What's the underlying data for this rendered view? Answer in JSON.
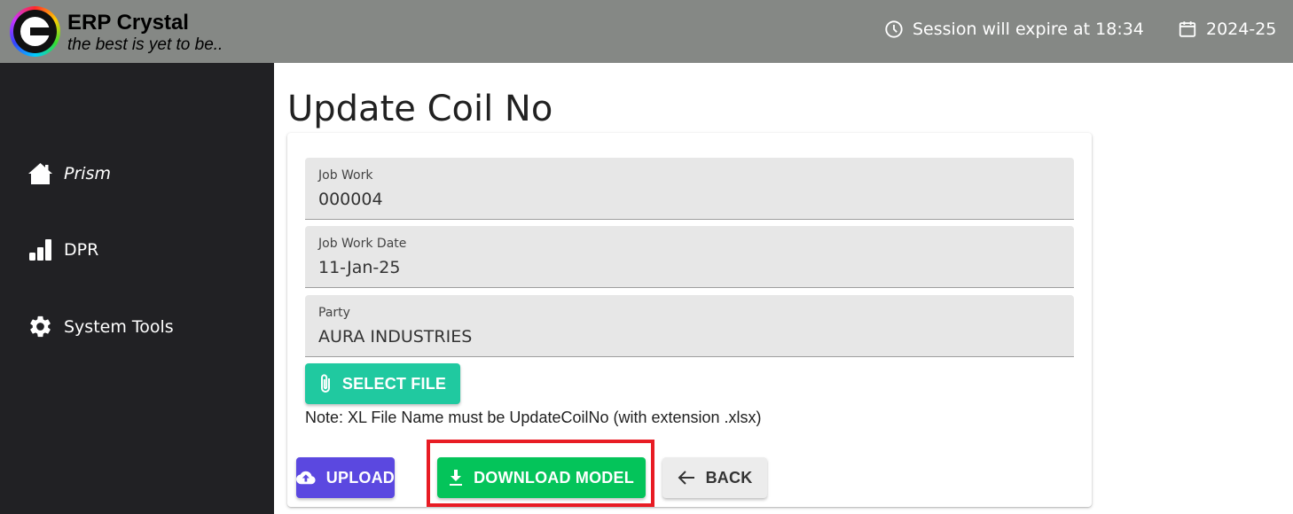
{
  "header": {
    "brand_title": "ERP Crystal",
    "brand_tagline": "the best is yet to be..",
    "session_text": "Session will expire at 18:34",
    "financial_year": "2024-25"
  },
  "sidebar": {
    "items": [
      {
        "label": "Prism",
        "icon": "home-icon"
      },
      {
        "label": "DPR",
        "icon": "bar-chart-icon"
      },
      {
        "label": "System Tools",
        "icon": "gear-icon"
      }
    ]
  },
  "page": {
    "title": "Update Coil No",
    "fields": [
      {
        "label": "Job Work",
        "value": "000004"
      },
      {
        "label": "Job Work Date",
        "value": "11-Jan-25"
      },
      {
        "label": "Party",
        "value": "AURA INDUSTRIES"
      }
    ],
    "select_file_label": "SELECT FILE",
    "note": "Note: XL File Name must be UpdateCoilNo (with extension .xlsx)",
    "buttons": {
      "upload": "UPLOAD",
      "download_model": "DOWNLOAD MODEL",
      "back": "BACK"
    }
  },
  "colors": {
    "topbar": "#858885",
    "sidebar": "#212124",
    "select_file": "#20c9a0",
    "upload": "#5b48e0",
    "download": "#04c45a",
    "back": "#ececec",
    "highlight": "#e81c24"
  }
}
